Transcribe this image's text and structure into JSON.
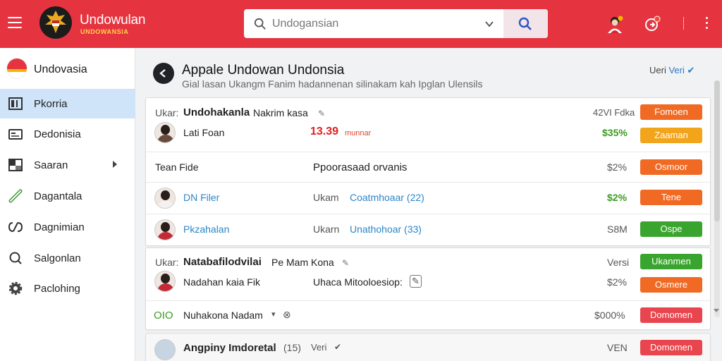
{
  "header": {
    "brand_title": "Undowulan",
    "brand_subtitle": "UNDOWANSIA",
    "search_placeholder": "Undogansian",
    "icons": [
      "menu-icon",
      "emblem-icon",
      "search-icon",
      "chevron-down-icon",
      "avatar-icon",
      "notification-icon",
      "more-vert-icon"
    ],
    "accent": "#e5343f"
  },
  "sidebar": {
    "title": "Undovasia",
    "items": [
      {
        "label": "Pkorria",
        "icon": "columns-icon",
        "active": true
      },
      {
        "label": "Dedonisia",
        "icon": "id-card-icon"
      },
      {
        "label": "Saaran",
        "icon": "grid-icon"
      },
      {
        "label": "Dagantala",
        "icon": "link-icon"
      },
      {
        "label": "Dagnimian",
        "icon": "loop-icon"
      },
      {
        "label": "Salgonlan",
        "icon": "search-icon"
      },
      {
        "label": "Paclohing",
        "icon": "gear-icon"
      }
    ]
  },
  "main": {
    "title": "Appale Undowan Undonsia",
    "subtitle": "Gial lasan Ukangm Fanim hadannenan silinakam kah Ipglan Ulensils",
    "verify_prefix": "Ueri",
    "verify_link": "Veri",
    "card1": {
      "head_prefix": "Ukar:",
      "head_title": "Undohakanla",
      "head_rest": "Nakrim kasa",
      "head_right": "42VI Fdka",
      "head_btn": "Fomoen",
      "rows": [
        {
          "name": "Lati Foan",
          "mid": "13.39",
          "mid_small": "munnar",
          "value": "$35%",
          "btn": "Zaaman"
        },
        {
          "name": "Tean Fide",
          "mid": "Ppoorasaad orvanis",
          "value": "$2%",
          "btn": "Osmoor"
        },
        {
          "name": "DN Filer",
          "mid_label": "Ukam",
          "mid": "Coatmhoaar (22)",
          "value": "$2%",
          "btn": "Tene"
        },
        {
          "name": "Pkzahalan",
          "mid_label": "Ukarn",
          "mid": "Unathohoar (33)",
          "value": "S8M",
          "btn": "Ospe"
        }
      ]
    },
    "card2": {
      "head_prefix": "Ukar:",
      "head_title": "Natabafilodvilai",
      "head_rest": "Pe Mam Kona",
      "head_right": "Versi",
      "head_btn": "Ukanmen",
      "rows": [
        {
          "name": "Nadahan kaia Fik",
          "mid": "Uhaca Mitooloesiop:",
          "value": "$2%",
          "btn": "Osmere"
        },
        {
          "name": "Nuhakona Nadam",
          "lead": "OIO",
          "value": "$000%",
          "btn": "Domomen"
        }
      ]
    },
    "card3": {
      "title": "Angpiny Imdoretal",
      "count": "(15)",
      "tag": "Veri",
      "value": "VEN",
      "btn": "Domomen"
    }
  }
}
